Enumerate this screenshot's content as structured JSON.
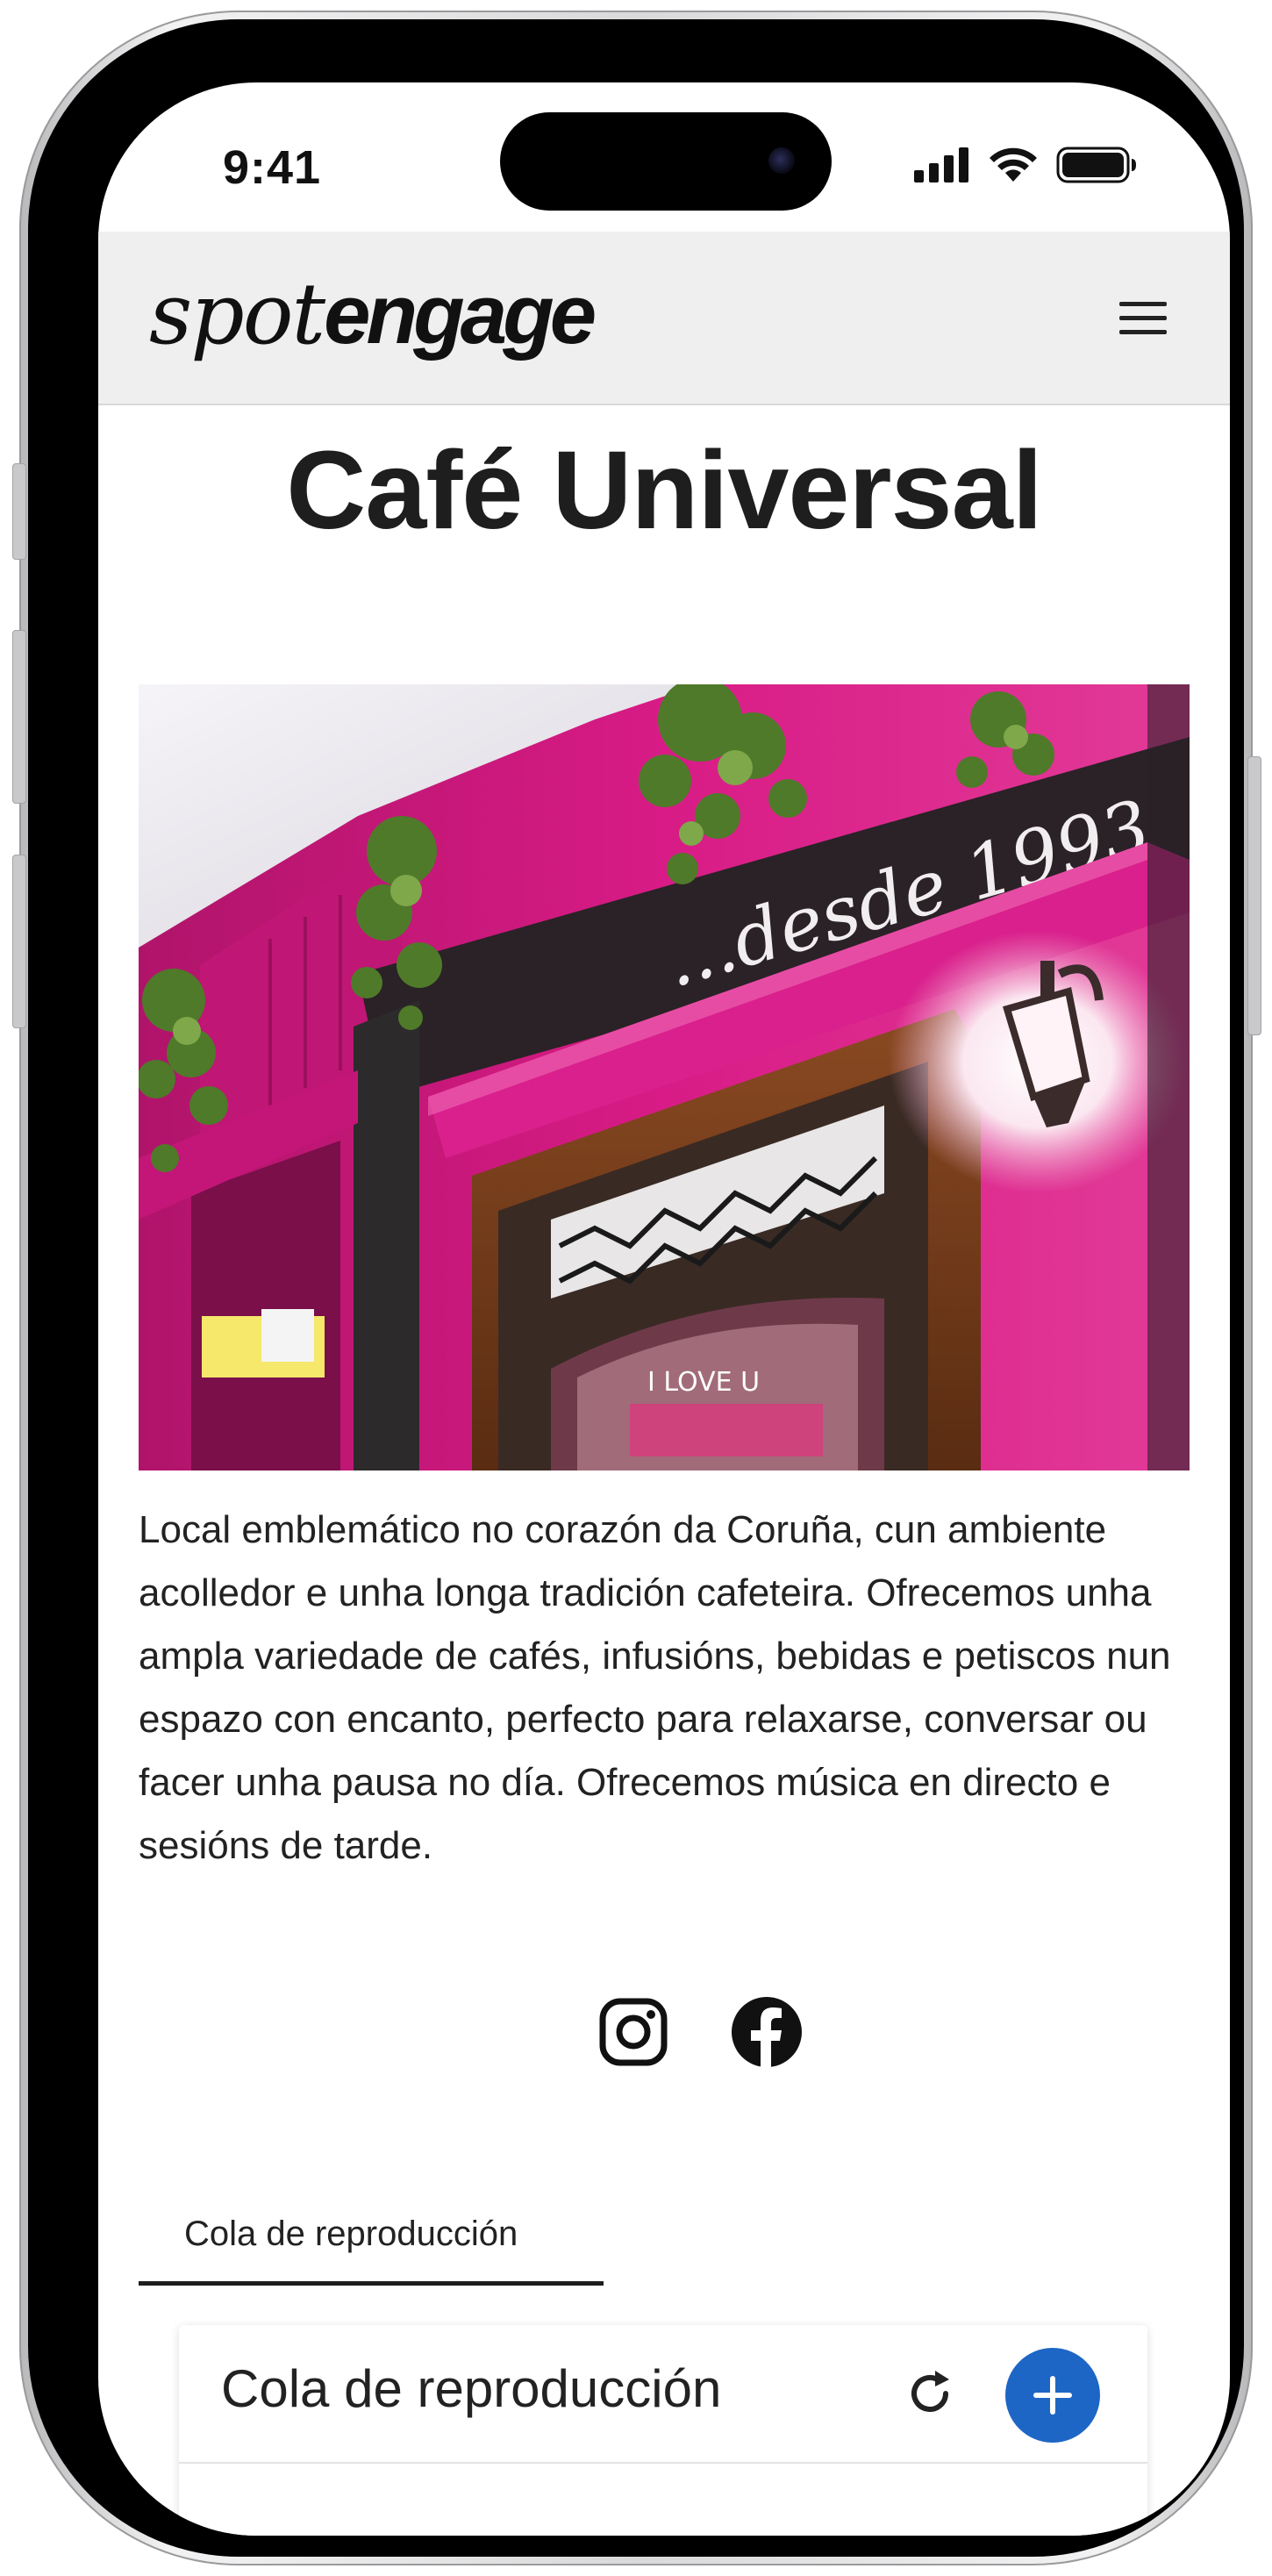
{
  "status_bar": {
    "time": "9:41",
    "icons": [
      "signal-icon",
      "wifi-icon",
      "battery-icon"
    ]
  },
  "header": {
    "logo_part1": "spot",
    "logo_part2": "engage",
    "menu_icon": "hamburger-menu-icon"
  },
  "venue": {
    "name": "Café Universal",
    "photo_sign_text": "...desde 1993",
    "description": "Local emblemático no corazón da Coruña, cun ambiente acolledor e unha longa tradición cafeteira. Ofrecemos unha ampla variedade de cafés, infusións, bebidas e petiscos nun espazo con encanto, perfecto para relaxarse, conversar ou facer unha pausa no día. Ofrecemos música en directo e sesións de tarde."
  },
  "social": [
    "instagram-icon",
    "facebook-icon"
  ],
  "tabs": [
    {
      "label": "Cola de reproducción",
      "active": true
    }
  ],
  "queue": {
    "title": "Cola de reproducción",
    "refresh_icon": "refresh-icon",
    "add_icon": "plus-icon"
  },
  "colors": {
    "header_bg": "#efefef",
    "accent": "#1e66c5",
    "facade_magenta": "#c2187a",
    "text": "#222222"
  }
}
